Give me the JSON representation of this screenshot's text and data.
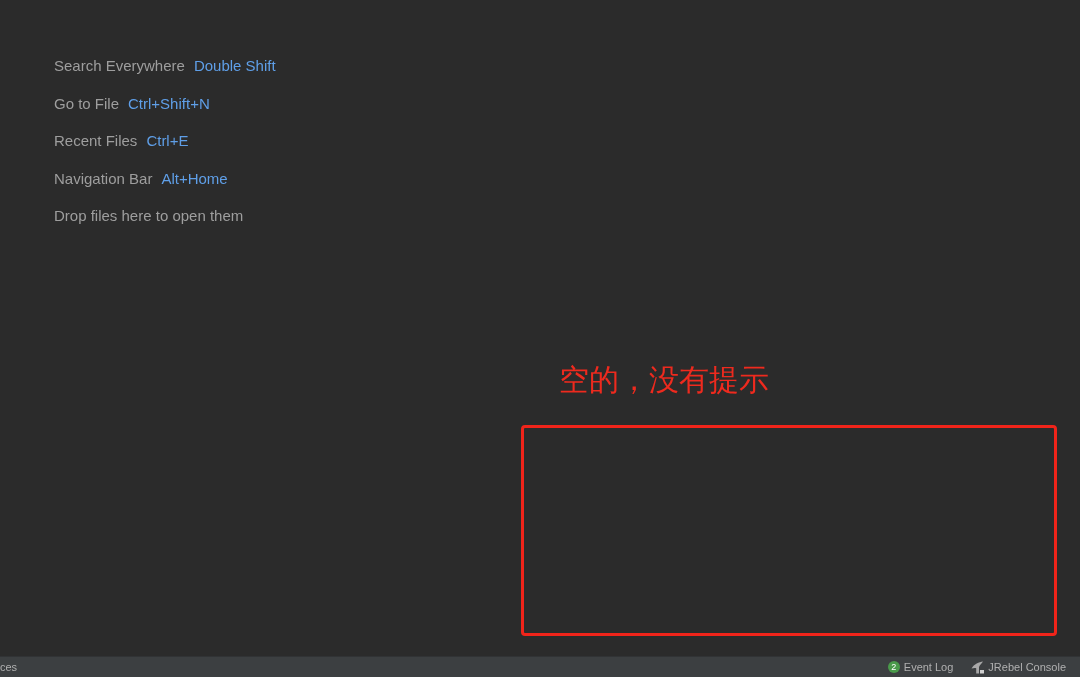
{
  "editor": {
    "hints": [
      {
        "action": "Search Everywhere",
        "shortcut": "Double Shift"
      },
      {
        "action": "Go to File",
        "shortcut": "Ctrl+Shift+N"
      },
      {
        "action": "Recent Files",
        "shortcut": "Ctrl+E"
      },
      {
        "action": "Navigation Bar",
        "shortcut": "Alt+Home"
      },
      {
        "action": "Drop files here to open them"
      }
    ]
  },
  "annotation": {
    "text": "空的，没有提示"
  },
  "status_bar": {
    "left_text": "ces",
    "items": [
      {
        "kind": "event_log",
        "badge": "2",
        "label": "Event Log"
      },
      {
        "kind": "console",
        "label": "JRebel Console"
      }
    ]
  }
}
